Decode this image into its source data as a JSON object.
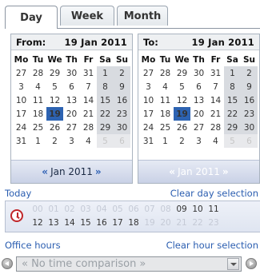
{
  "tabs": [
    "Day",
    "Week",
    "Month"
  ],
  "weekdays": [
    "Mo",
    "Tu",
    "We",
    "Th",
    "Fr",
    "Sa",
    "Su"
  ],
  "calendars": [
    {
      "label": "From:",
      "date": "19 Jan 2011",
      "nav_text": "Jan 2011",
      "weeks": [
        [
          "27",
          "28",
          "29",
          "30",
          "31",
          "1",
          "2"
        ],
        [
          "3",
          "4",
          "5",
          "6",
          "7",
          "8",
          "9"
        ],
        [
          "10",
          "11",
          "12",
          "13",
          "14",
          "15",
          "16"
        ],
        [
          "17",
          "18",
          "19",
          "20",
          "21",
          "22",
          "23"
        ],
        [
          "24",
          "25",
          "26",
          "27",
          "28",
          "29",
          "30"
        ],
        [
          "31",
          "1",
          "2",
          "3",
          "4",
          "5",
          "6"
        ]
      ]
    },
    {
      "label": "To:",
      "date": "19 Jan 2011",
      "nav_text": "Jan 2011",
      "weeks": [
        [
          "27",
          "28",
          "29",
          "30",
          "31",
          "1",
          "2"
        ],
        [
          "3",
          "4",
          "5",
          "6",
          "7",
          "8",
          "9"
        ],
        [
          "10",
          "11",
          "12",
          "13",
          "14",
          "15",
          "16"
        ],
        [
          "17",
          "18",
          "19",
          "20",
          "21",
          "22",
          "23"
        ],
        [
          "24",
          "25",
          "26",
          "27",
          "28",
          "29",
          "30"
        ],
        [
          "31",
          "1",
          "2",
          "3",
          "4",
          "5",
          "6"
        ]
      ]
    }
  ],
  "nav_prev": "«",
  "nav_next": "»",
  "links": {
    "today": "Today",
    "clear_day": "Clear day selection",
    "office_hours": "Office hours",
    "clear_hour": "Clear hour selection"
  },
  "hours": {
    "row1": [
      "00",
      "01",
      "02",
      "03",
      "04",
      "05",
      "06",
      "07",
      "08",
      "09",
      "10",
      "11"
    ],
    "row2": [
      "12",
      "13",
      "14",
      "15",
      "16",
      "17",
      "18",
      "19",
      "20",
      "21",
      "22",
      "23"
    ]
  },
  "comparison": {
    "value": "« No time comparison »"
  }
}
